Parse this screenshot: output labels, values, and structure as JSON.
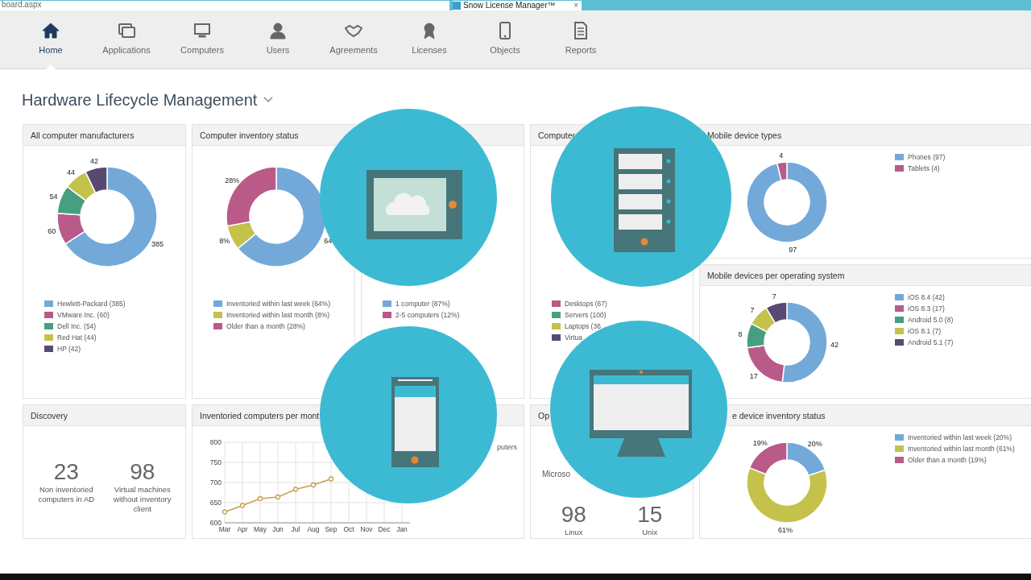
{
  "browser": {
    "address": "board.aspx",
    "tab_title": "Snow License Manager™",
    "tab_close": "×"
  },
  "nav": [
    {
      "label": "Home",
      "selected": true
    },
    {
      "label": "Applications",
      "selected": false
    },
    {
      "label": "Computers",
      "selected": false
    },
    {
      "label": "Users",
      "selected": false
    },
    {
      "label": "Agreements",
      "selected": false
    },
    {
      "label": "Licenses",
      "selected": false
    },
    {
      "label": "Objects",
      "selected": false
    },
    {
      "label": "Reports",
      "selected": false
    }
  ],
  "page_title": "Hardware Lifecycle Management",
  "panels": [
    {
      "kind": "donut",
      "title": "All computer manufacturers",
      "chart_data": {
        "type": "donut",
        "values": [
          385,
          60,
          54,
          44,
          42
        ],
        "value_labels": [
          "385",
          "60",
          "54",
          "44",
          "42"
        ]
      },
      "legend": [
        {
          "label": "Hewlett-Packard (385)",
          "color": "#73a9d9"
        },
        {
          "label": "VMware Inc. (60)",
          "color": "#b95a88"
        },
        {
          "label": "Dell Inc. (54)",
          "color": "#46a07f"
        },
        {
          "label": "Red Hat (44)",
          "color": "#c4c24a"
        },
        {
          "label": "HP (42)",
          "color": "#574a72"
        }
      ]
    },
    {
      "kind": "donut",
      "title": "Computer inventory status",
      "chart_data": {
        "type": "donut",
        "values": [
          64,
          8,
          28
        ],
        "value_labels": [
          "64",
          "8%",
          "28%"
        ]
      },
      "legend": [
        {
          "label": "Inventoried within last week (64%)",
          "color": "#73a9d9"
        },
        {
          "label": "Inventoried within last month (8%)",
          "color": "#c4c24a"
        },
        {
          "label": "Older than a month (28%)",
          "color": "#b95a88"
        }
      ]
    },
    {
      "kind": "legend",
      "legend": [
        {
          "label": "1 computer (87%)",
          "color": "#73a9d9"
        },
        {
          "label": "2-5 computers (12%)",
          "color": "#b95a88"
        }
      ]
    },
    {
      "kind": "legend",
      "title": "Computer",
      "legend": [
        {
          "label": "Desktops (67)",
          "color": "#b95a88"
        },
        {
          "label": "Servers (100)",
          "color": "#46a07f"
        },
        {
          "label": "Laptops (36",
          "color": "#c4c24a"
        },
        {
          "label": "Virtua",
          "color": "#574a72"
        }
      ]
    },
    {
      "kind": "donut_side",
      "title": "Mobile device types",
      "chart_data": {
        "type": "donut",
        "values": [
          97,
          4
        ],
        "value_labels": [
          "97",
          "4"
        ]
      },
      "legend": [
        {
          "label": "Phones (97)",
          "color": "#73a9d9"
        },
        {
          "label": "Tablets (4)",
          "color": "#b95a88"
        }
      ]
    },
    {
      "kind": "donut_side",
      "title": "Mobile devices per operating system",
      "chart_data": {
        "type": "donut",
        "values": [
          42,
          17,
          8,
          7,
          7
        ],
        "value_labels": [
          "42",
          "17",
          "8",
          "7",
          "7"
        ]
      },
      "legend": [
        {
          "label": "iOS 8.4 (42)",
          "color": "#73a9d9"
        },
        {
          "label": "iOS 8.3 (17)",
          "color": "#b95a88"
        },
        {
          "label": "Android 5.0 (8)",
          "color": "#46a07f"
        },
        {
          "label": "iOS 8.1 (7)",
          "color": "#c4c24a"
        },
        {
          "label": "Android 5.1 (7)",
          "color": "#574a72"
        }
      ]
    },
    {
      "kind": "stats",
      "title": "Discovery",
      "stats": [
        {
          "value": "23",
          "label": "Non inventoried computers in AD"
        },
        {
          "value": "98",
          "label": "Virtual machines without inventory client"
        }
      ]
    },
    {
      "kind": "line",
      "title": "Inventoried computers per mont",
      "chart_data": {
        "type": "line",
        "categories": [
          "Mar",
          "Apr",
          "May",
          "Jun",
          "Jul",
          "Aug",
          "Sep",
          "Oct",
          "Nov",
          "Dec",
          "Jan"
        ],
        "series": [
          {
            "color": "#c9a050",
            "marker": true,
            "values": [
              627,
              643,
              660,
              664,
              683,
              694,
              709,
              null,
              null,
              null,
              null
            ]
          }
        ],
        "grid": true,
        "ylim": [
          600,
          800
        ],
        "yticks": [
          600,
          650,
          700,
          750,
          800
        ]
      },
      "legend_fragment": "puters"
    },
    {
      "kind": "stats",
      "title": "Op",
      "note": "Microso",
      "stats": [
        {
          "value": "98",
          "label": "Linux"
        },
        {
          "value": "15",
          "label": "Unix"
        }
      ]
    },
    {
      "kind": "donut_side",
      "title": "e device inventory status",
      "chart_data": {
        "type": "donut",
        "values": [
          20,
          61,
          19
        ],
        "value_labels": [
          "20%",
          "61%",
          "19%"
        ]
      },
      "legend": [
        {
          "label": "Inventoried within last week (20%)",
          "color": "#73a9d9"
        },
        {
          "label": "Inventoried within last month (61%)",
          "color": "#c4c24a"
        },
        {
          "label": "Older than a month (19%)",
          "color": "#b95a88"
        }
      ]
    }
  ]
}
